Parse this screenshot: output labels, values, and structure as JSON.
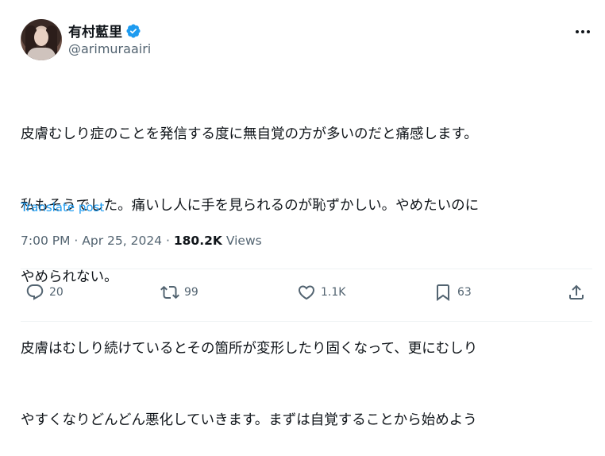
{
  "author": {
    "display_name": "有村藍里",
    "handle": "@arimuraairi",
    "avatar_icon": "avatar-photo",
    "verified_icon": "verified-badge-icon"
  },
  "tweet": {
    "lines": [
      "皮膚むしり症のことを発信する度に無自覚の方が多いのだと痛感します。",
      "私もそうでした。痛いし人に手を見られるのが恥ずかしい。やめたいのに",
      "やめられない。",
      "皮膚はむしり続けているとその箇所が変形したり固くなって、更にむしり",
      "やすくなりどんどん悪化していきます。まずは自覚することから始めよう"
    ],
    "translate_label": "Translate post"
  },
  "meta": {
    "time": "7:00 PM",
    "separator": "·",
    "date": "Apr 25, 2024",
    "views_count": "180.2K",
    "views_label": "Views"
  },
  "actions": {
    "replies": "20",
    "reposts": "99",
    "likes": "1.1K",
    "bookmarks": "63"
  },
  "colors": {
    "text": "#0f1419",
    "secondary": "#536471",
    "accent": "#1d9bf0",
    "divider": "#eff3f4"
  }
}
